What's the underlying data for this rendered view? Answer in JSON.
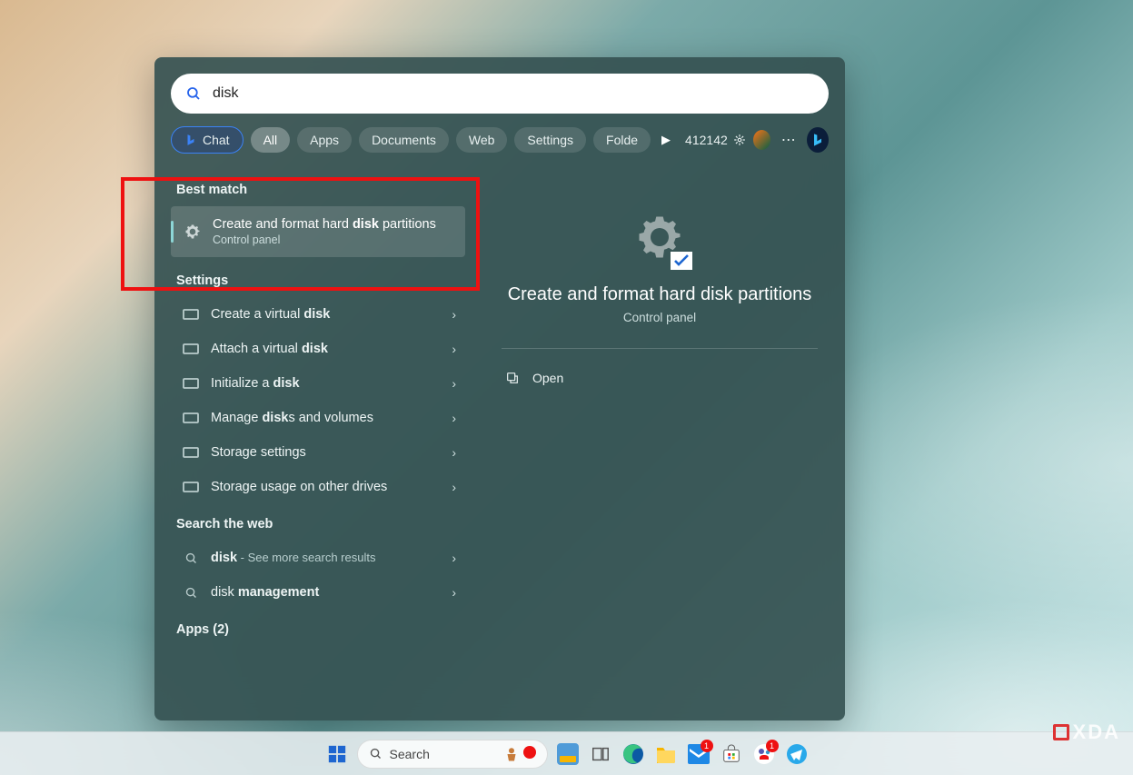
{
  "search": {
    "value": "disk"
  },
  "filters": {
    "chat": "Chat",
    "all": "All",
    "apps": "Apps",
    "documents": "Documents",
    "web": "Web",
    "settings": "Settings",
    "folders": "Folde"
  },
  "points": "412142",
  "sections": {
    "best_match": "Best match",
    "settings": "Settings",
    "search_web": "Search the web",
    "apps": "Apps (2)"
  },
  "best_match": {
    "title_pre": "Create and format hard ",
    "title_bold": "disk",
    "title_post": " partitions",
    "subtitle": "Control panel"
  },
  "settings_results": [
    {
      "pre": "Create a virtual ",
      "bold": "disk",
      "post": ""
    },
    {
      "pre": "Attach a virtual ",
      "bold": "disk",
      "post": ""
    },
    {
      "pre": "Initialize a ",
      "bold": "disk",
      "post": ""
    },
    {
      "pre": "Manage ",
      "bold": "disk",
      "post": "s and volumes"
    },
    {
      "pre": "Storage settings",
      "bold": "",
      "post": ""
    },
    {
      "pre": "Storage usage on other drives",
      "bold": "",
      "post": ""
    }
  ],
  "web_results": [
    {
      "pre": "",
      "bold": "disk",
      "post": "",
      "sub": " - See more search results"
    },
    {
      "pre": "disk ",
      "bold": "management",
      "post": "",
      "sub": ""
    }
  ],
  "preview": {
    "title": "Create and format hard disk partitions",
    "subtitle": "Control panel",
    "open": "Open"
  },
  "taskbar": {
    "search": "Search",
    "mail_badge": "1",
    "teams_badge": "1"
  },
  "watermark": "XDA"
}
